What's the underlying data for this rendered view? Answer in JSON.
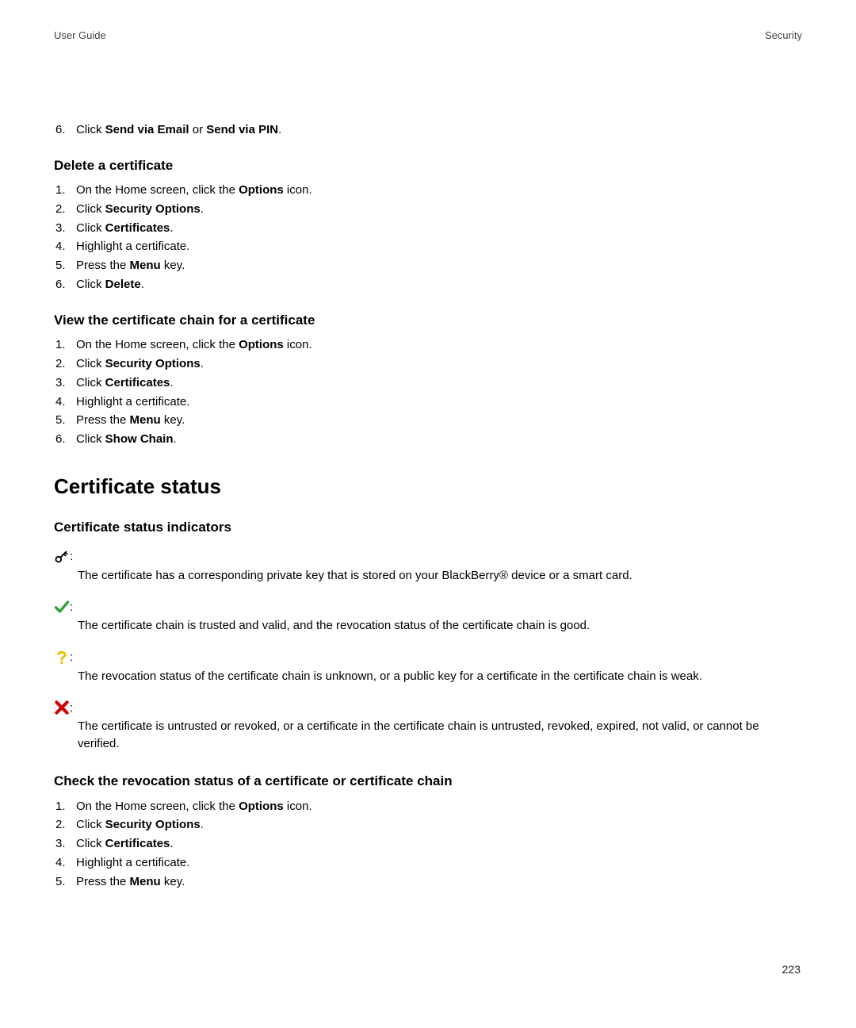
{
  "header": {
    "left": "User Guide",
    "right": "Security"
  },
  "firstLine": {
    "num": "6.",
    "parts": [
      "Click ",
      "Send via Email",
      " or ",
      "Send via PIN",
      "."
    ]
  },
  "sectionDelete": {
    "heading": "Delete a certificate",
    "steps": [
      {
        "num": "1.",
        "parts": [
          "On the Home screen, click the ",
          "Options",
          " icon."
        ]
      },
      {
        "num": "2.",
        "parts": [
          "Click ",
          "Security Options",
          "."
        ]
      },
      {
        "num": "3.",
        "parts": [
          "Click ",
          "Certificates",
          "."
        ]
      },
      {
        "num": "4.",
        "parts": [
          "Highlight a certificate."
        ]
      },
      {
        "num": "5.",
        "parts": [
          "Press the ",
          "Menu",
          " key."
        ]
      },
      {
        "num": "6.",
        "parts": [
          "Click ",
          "Delete",
          "."
        ]
      }
    ]
  },
  "sectionView": {
    "heading": "View the certificate chain for a certificate",
    "steps": [
      {
        "num": "1.",
        "parts": [
          "On the Home screen, click the ",
          "Options",
          " icon."
        ]
      },
      {
        "num": "2.",
        "parts": [
          "Click ",
          "Security Options",
          "."
        ]
      },
      {
        "num": "3.",
        "parts": [
          "Click ",
          "Certificates",
          "."
        ]
      },
      {
        "num": "4.",
        "parts": [
          "Highlight a certificate."
        ]
      },
      {
        "num": "5.",
        "parts": [
          "Press the ",
          "Menu",
          " key."
        ]
      },
      {
        "num": "6.",
        "parts": [
          "Click ",
          "Show Chain",
          "."
        ]
      }
    ]
  },
  "h2": "Certificate status",
  "indicatorsHeading": "Certificate status indicators",
  "indicators": [
    {
      "icon": "key-icon",
      "colon": ":",
      "desc": "The certificate has a corresponding private key that is stored on your BlackBerry® device or a smart card."
    },
    {
      "icon": "checkmark-green-icon",
      "colon": ":",
      "desc": "The certificate chain is trusted and valid, and the revocation status of the certificate chain is good."
    },
    {
      "icon": "question-yellow-icon",
      "colon": ":",
      "desc": "The revocation status of the certificate chain is unknown, or a public key for a certificate in the certificate chain is weak."
    },
    {
      "icon": "cross-red-icon",
      "colon": ":",
      "desc": "The certificate is untrusted or revoked, or a certificate in the certificate chain is untrusted, revoked, expired, not valid, or cannot be verified."
    }
  ],
  "sectionCheck": {
    "heading": "Check the revocation status of a certificate or certificate chain",
    "steps": [
      {
        "num": "1.",
        "parts": [
          "On the Home screen, click the ",
          "Options",
          " icon."
        ]
      },
      {
        "num": "2.",
        "parts": [
          "Click ",
          "Security Options",
          "."
        ]
      },
      {
        "num": "3.",
        "parts": [
          "Click ",
          "Certificates",
          "."
        ]
      },
      {
        "num": "4.",
        "parts": [
          "Highlight a certificate."
        ]
      },
      {
        "num": "5.",
        "parts": [
          "Press the ",
          "Menu",
          " key."
        ]
      }
    ]
  },
  "pageNumber": "223"
}
